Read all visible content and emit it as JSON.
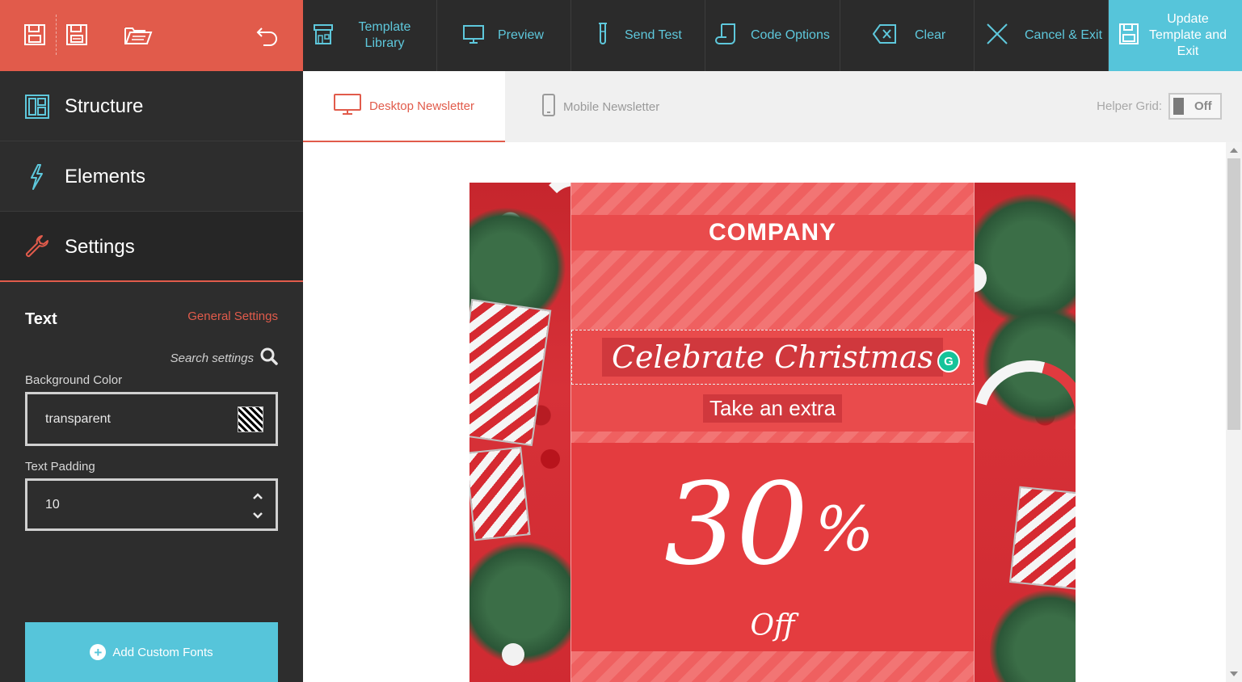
{
  "quick_toolbar": {
    "icons": [
      "save-icon",
      "save-as-icon",
      "open-folder-icon",
      "undo-icon"
    ]
  },
  "sidebar": {
    "items": [
      {
        "label": "Structure",
        "icon": "layout-icon"
      },
      {
        "label": "Elements",
        "icon": "lightning-icon"
      },
      {
        "label": "Settings",
        "icon": "wrench-icon"
      }
    ]
  },
  "settings_panel": {
    "title": "Text",
    "general_link": "General Settings",
    "search_label": "Search settings",
    "background_color": {
      "label": "Background Color",
      "value": "transparent"
    },
    "text_padding": {
      "label": "Text Padding",
      "value": "10"
    },
    "add_fonts_label": "Add Custom Fonts"
  },
  "toolbar": {
    "template_library": "Template Library",
    "preview": "Preview",
    "send_test": "Send Test",
    "code_options": "Code Options",
    "clear": "Clear",
    "cancel_exit": "Cancel & Exit",
    "update": "Update Template and Exit"
  },
  "tabs": {
    "desktop": "Desktop Newsletter",
    "mobile": "Mobile Newsletter",
    "helper_grid_label": "Helper Grid:",
    "helper_grid_state": "Off"
  },
  "newsletter": {
    "company": "COMPANY",
    "headline": "Celebrate Christmas",
    "subhead": "Take an extra",
    "percent_number": "30",
    "percent_symbol": "%",
    "off": "Off"
  },
  "colors": {
    "accent_red": "#e15b4b",
    "accent_cyan": "#56c5da",
    "sidebar_bg": "#2d2d2d",
    "toolbar_bg": "#2b2b2b"
  }
}
